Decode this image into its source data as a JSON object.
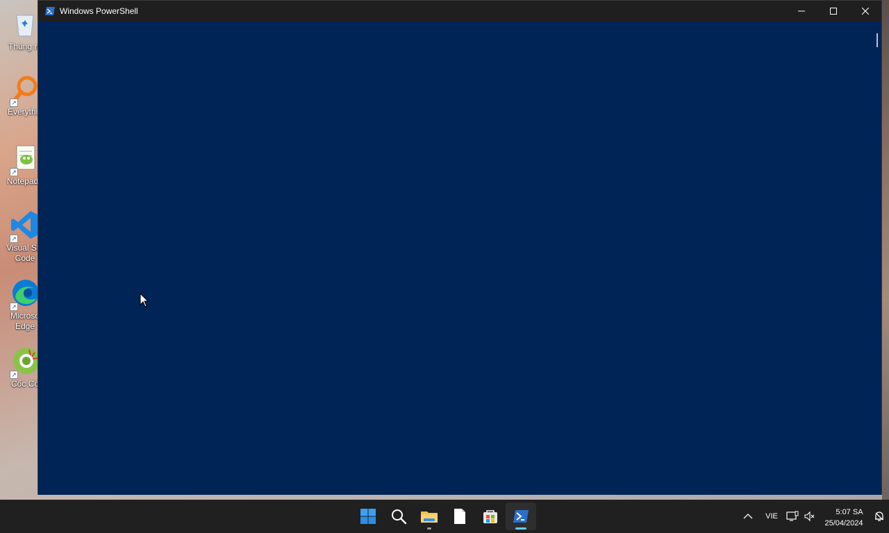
{
  "desktop": {
    "icons": [
      {
        "label": "Thùng rá",
        "icon": "recycle-bin-icon"
      },
      {
        "label": "Everythin",
        "icon": "everything-search-icon"
      },
      {
        "label": "Notepad+",
        "icon": "notepad-plus-plus-icon"
      },
      {
        "label": "Visual Stu",
        "label2": "Code",
        "icon": "vscode-icon"
      },
      {
        "label": "Microso",
        "label2": "Edge",
        "icon": "edge-icon"
      },
      {
        "label": "Cốc Cố",
        "icon": "coccoc-icon"
      }
    ]
  },
  "window": {
    "title": "Windows PowerShell",
    "background_color": "#012456",
    "titlebar_color": "#1f1f1f",
    "controls": {
      "minimize": "minimize-icon",
      "maximize": "maximize-icon",
      "close": "close-icon"
    }
  },
  "taskbar": {
    "apps": [
      {
        "name": "Start",
        "icon": "windows-start-icon"
      },
      {
        "name": "Search",
        "icon": "search-icon"
      },
      {
        "name": "File Explorer",
        "icon": "folder-icon"
      },
      {
        "name": "Notepad",
        "icon": "document-icon"
      },
      {
        "name": "Microsoft Store",
        "icon": "store-icon"
      },
      {
        "name": "Windows PowerShell",
        "icon": "powershell-icon"
      }
    ],
    "tray": {
      "language": "VIE",
      "time": "5:07 SA",
      "date": "25/04/2024"
    }
  },
  "colors": {
    "accent": "#60cdff",
    "taskbar": "#202020"
  }
}
